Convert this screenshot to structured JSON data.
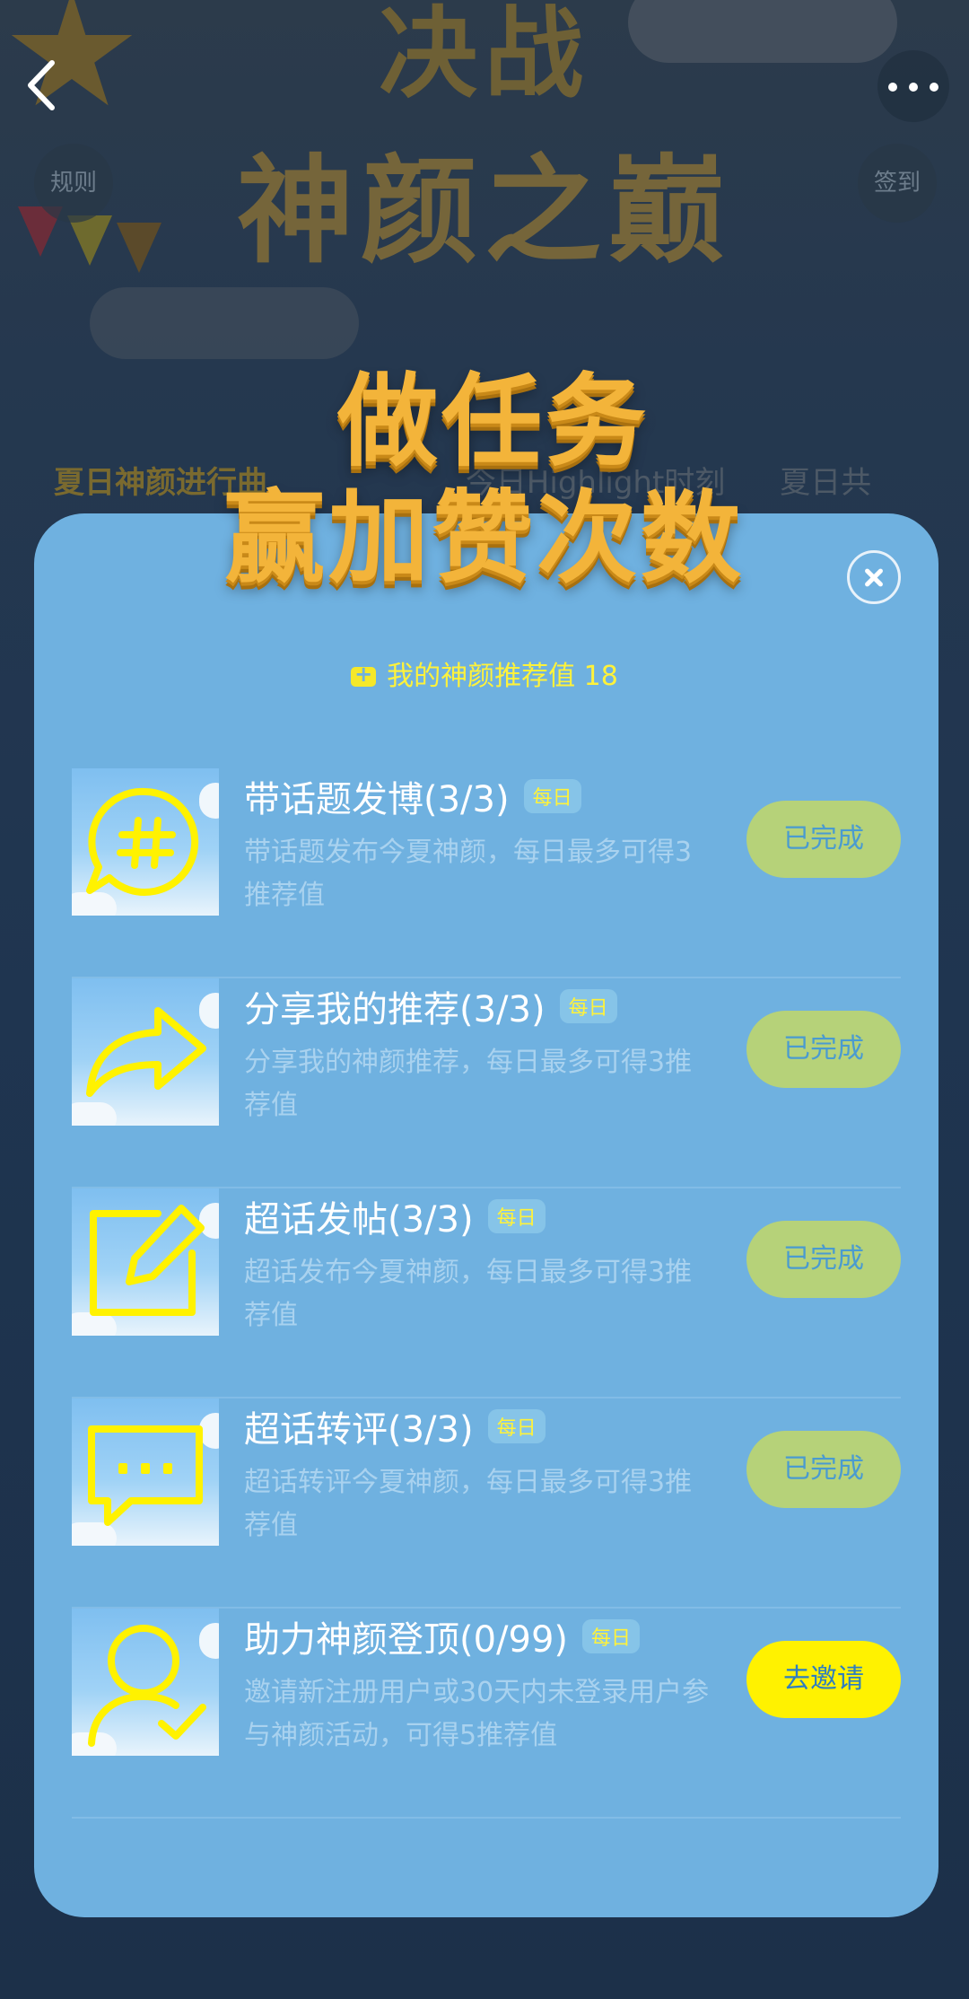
{
  "background": {
    "title_line1": "决战",
    "title_line2": "神颜之巅",
    "rules_label": "规则",
    "checkin_label": "签到",
    "tabs": [
      "夏日神颜进行曲",
      "今日Highlight时刻",
      "夏日共"
    ]
  },
  "modal": {
    "title_line1": "做任务",
    "title_line2": "赢加赞次数",
    "score_label": "我的神颜推荐值",
    "score_value": "18",
    "tasks": [
      {
        "title": "带话题发博(3/3)",
        "badge": "每日",
        "desc": "带话题发布今夏神颜，每日最多可得3推荐值",
        "button": "已完成",
        "icon": "hashtag-bubble-icon"
      },
      {
        "title": "分享我的推荐(3/3)",
        "badge": "每日",
        "desc": "分享我的神颜推荐，每日最多可得3推荐值",
        "button": "已完成",
        "icon": "share-arrow-icon"
      },
      {
        "title": "超话发帖(3/3)",
        "badge": "每日",
        "desc": "超话发布今夏神颜，每日最多可得3推荐值",
        "button": "已完成",
        "icon": "edit-pencil-icon"
      },
      {
        "title": "超话转评(3/3)",
        "badge": "每日",
        "desc": "超话转评今夏神颜，每日最多可得3推荐值",
        "button": "已完成",
        "icon": "comment-bubble-icon"
      },
      {
        "title": "助力神颜登顶(0/99)",
        "badge": "每日",
        "desc": "邀请新注册用户或30天内未登录用户参与神颜活动，可得5推荐值",
        "button": "去邀请",
        "icon": "invite-user-icon"
      }
    ]
  },
  "colors": {
    "modal_bg": "#6fb1e0",
    "accent_yellow": "#fff200",
    "done_button": "#b6d279",
    "title_gold": "#f3b43a"
  }
}
